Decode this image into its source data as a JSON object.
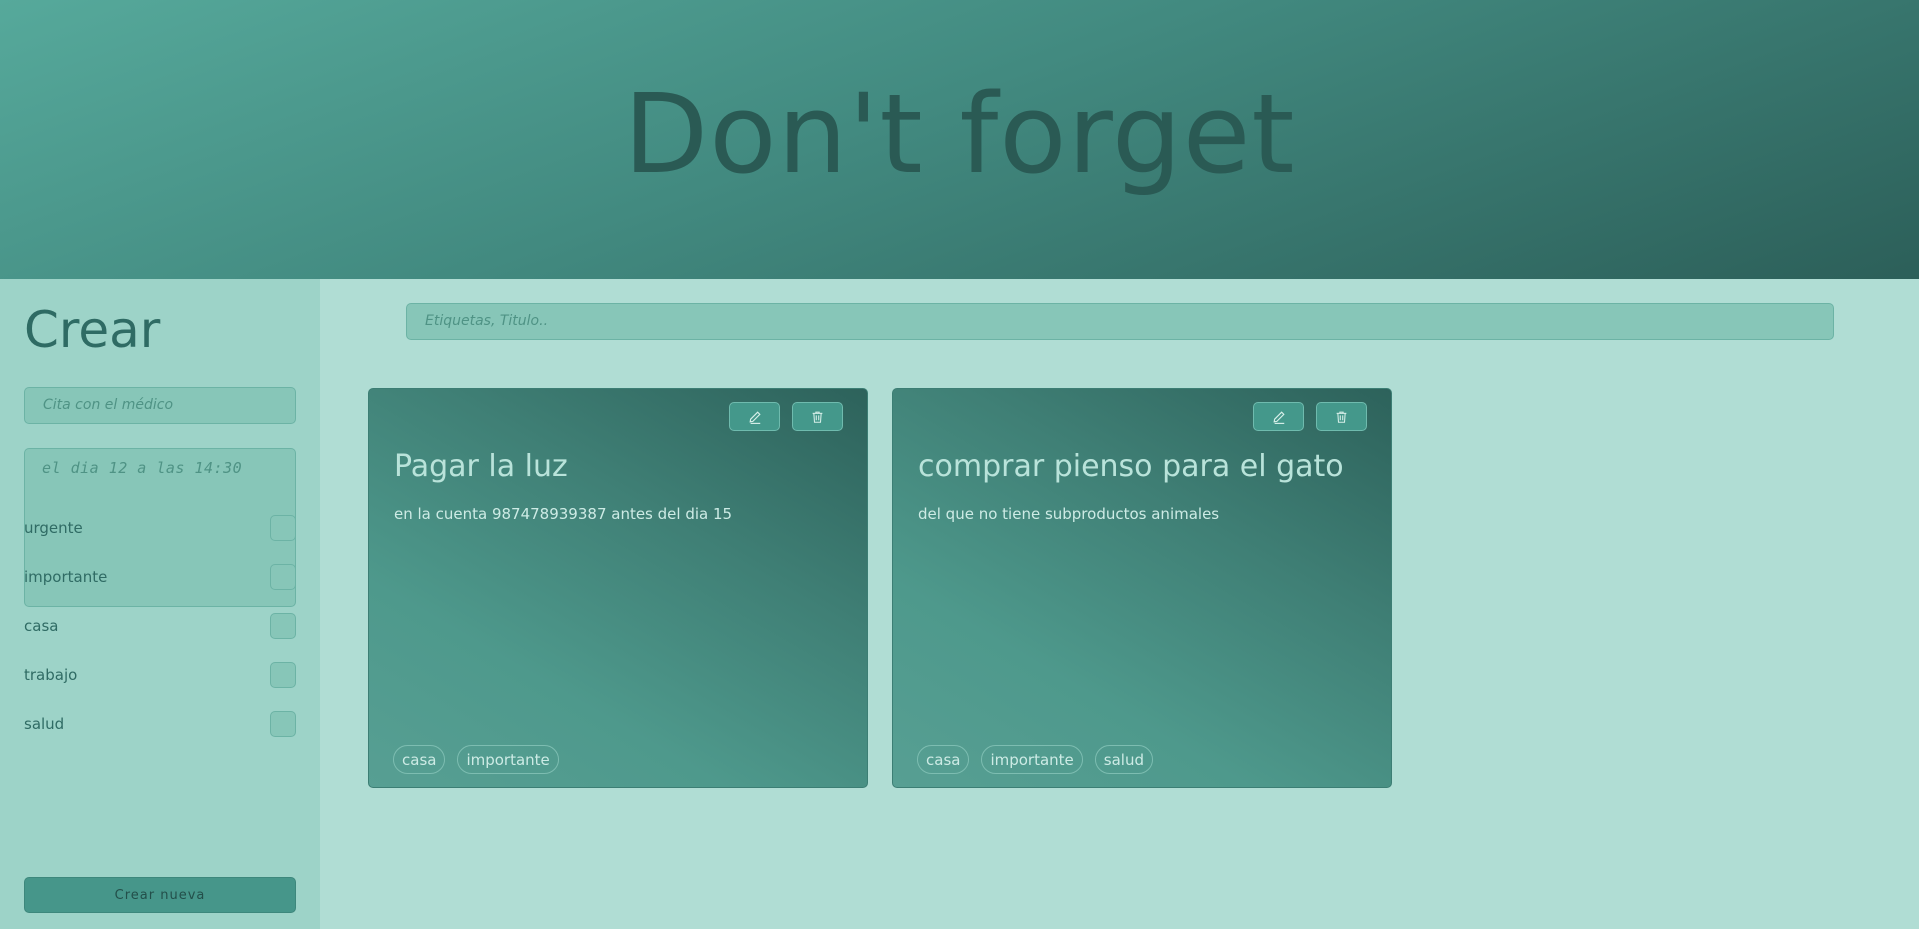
{
  "header": {
    "title": "Don't forget"
  },
  "sidebar": {
    "heading": "Crear",
    "title_placeholder": "Cita con el médico",
    "description_placeholder": "el dia 12 a las 14:30",
    "tags": [
      {
        "label": "urgente",
        "checked": false
      },
      {
        "label": "importante",
        "checked": false
      },
      {
        "label": "casa",
        "checked": false
      },
      {
        "label": "trabajo",
        "checked": false
      },
      {
        "label": "salud",
        "checked": false
      }
    ],
    "create_button": "Crear nueva"
  },
  "search": {
    "placeholder": "Etiquetas, Titulo.."
  },
  "notes": [
    {
      "title": "Pagar la luz",
      "text": "en la cuenta 987478939387 antes del dia 15",
      "tags": [
        "casa",
        "importante"
      ]
    },
    {
      "title": "comprar pienso para el gato",
      "text": "del que no tiene subproductos animales",
      "tags": [
        "casa",
        "importante",
        "salud"
      ]
    }
  ],
  "icons": {
    "edit": "pencil-icon",
    "delete": "trash-icon"
  },
  "colors": {
    "header_text": "#2a5a54",
    "accent": "#46968a",
    "background": "#b0ddd4"
  }
}
